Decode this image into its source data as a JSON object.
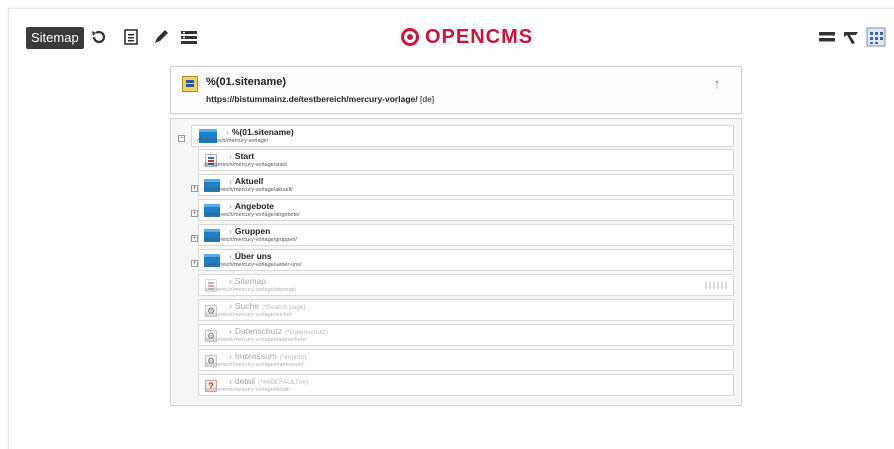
{
  "toolbar": {
    "sitemap_label": "Sitemap",
    "logo_text": "OPENCMS"
  },
  "site": {
    "title": "%(01.sitename)",
    "url": "https://bistummainz.de/testbereich/mercury-vorlage/",
    "locale": "[de]"
  },
  "tree": {
    "root": {
      "title": "%(01.sitename)",
      "path": "/testbereich/mercury-vorlage/"
    },
    "items": [
      {
        "title": "Start",
        "path": "/testbereich/mercury-vorlage/start/"
      },
      {
        "title": "Aktuell",
        "path": "/testbereich/mercury-vorlage/aktuell/"
      },
      {
        "title": "Angebote",
        "path": "/testbereich/mercury-vorlage/angebote/"
      },
      {
        "title": "Gruppen",
        "path": "/testbereich/mercury-vorlage/gruppen/"
      },
      {
        "title": "Über uns",
        "path": "/testbereich/mercury-vorlage/ueber-uns/"
      },
      {
        "title": "Sitemap",
        "path": "/testbereich/mercury-vorlage/sitemap/"
      },
      {
        "title": "Suche",
        "sub": "(*Search page)",
        "path": "/testbereich/mercury-vorlage/suche/"
      },
      {
        "title": "Datenschutz",
        "sub": "(*Datenschutz)",
        "path": "/testbereich/mercury-vorlage/datenschutz/"
      },
      {
        "title": "Impressum",
        "sub": "(*imprint)",
        "path": "/testbereich/mercury-vorlage/impressum/"
      },
      {
        "title": "detail",
        "sub": "(*##DEFAULT##)",
        "path": "/testbereich/mercury-vorlage/detail/"
      }
    ]
  }
}
